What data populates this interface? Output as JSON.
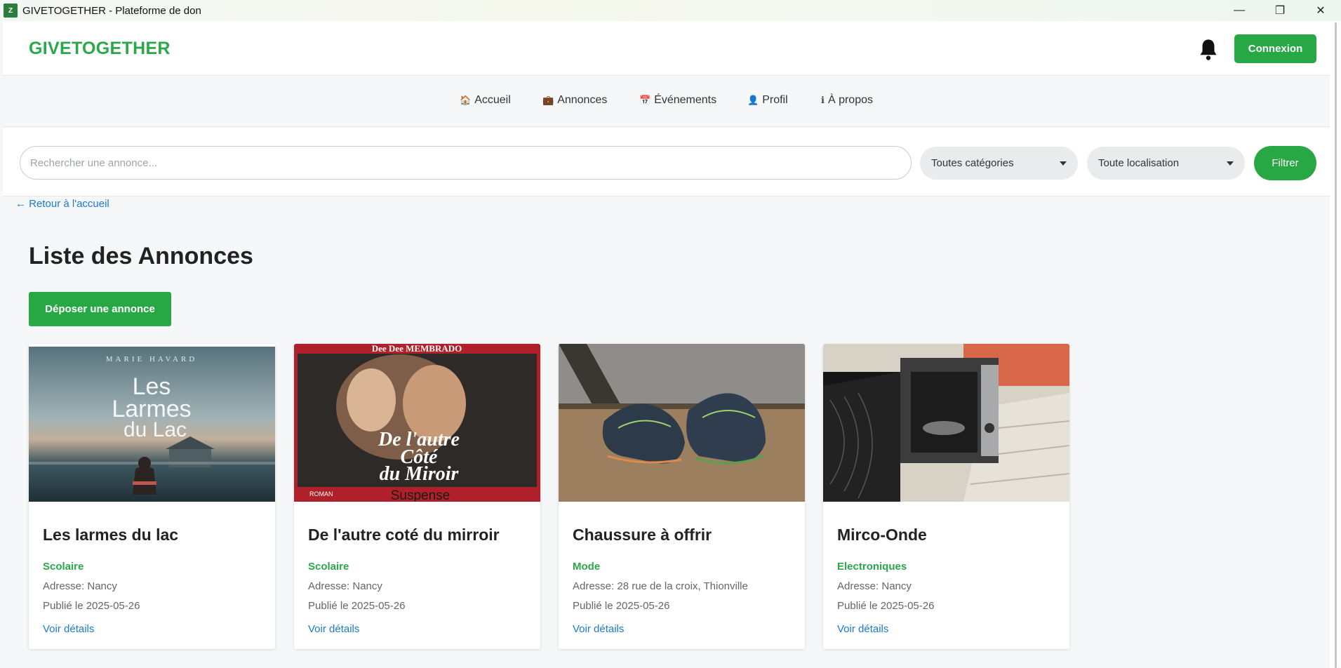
{
  "window": {
    "title": "GIVETOGETHER - Plateforme de don",
    "minimize_glyph": "—",
    "restore_glyph": "❐",
    "close_glyph": "✕"
  },
  "header": {
    "brand": "GIVETOGETHER",
    "login_label": "Connexion"
  },
  "nav": {
    "items": [
      {
        "icon": "🏠",
        "label": "Accueil"
      },
      {
        "icon": "💼",
        "label": "Annonces"
      },
      {
        "icon": "📅",
        "label": "Événements"
      },
      {
        "icon": "👤",
        "label": "Profil"
      },
      {
        "icon": "ℹ",
        "label": "À propos"
      }
    ]
  },
  "search": {
    "placeholder": "Rechercher une annonce...",
    "category_select": "Toutes catégories",
    "location_select": "Toute localisation",
    "filter_label": "Filtrer"
  },
  "content": {
    "back_link": "← Retour à l'accueil",
    "title": "Liste des Annonces",
    "post_button": "Déposer une annonce"
  },
  "cards": [
    {
      "title": "Les larmes du lac",
      "category": "Scolaire",
      "address": "Adresse: Nancy",
      "published": "Publié le 2025-05-26",
      "link": "Voir détails",
      "image_author": "MARIE HAVARD",
      "image_text": [
        "Les",
        "Larmes",
        "du Lac"
      ]
    },
    {
      "title": "De l'autre coté du mirroir",
      "category": "Scolaire",
      "address": "Adresse: Nancy",
      "published": "Publié le 2025-05-26",
      "link": "Voir détails",
      "image_author": "Dee Dee MEMBRADO",
      "image_text": [
        "De l'autre",
        "Côté",
        "du Miroir"
      ],
      "image_genre": "ROMAN",
      "image_sub": "Suspense"
    },
    {
      "title": "Chaussure à offrir",
      "category": "Mode",
      "address": "Adresse: 28 rue de la croix, Thionville",
      "published": "Publié le 2025-05-26",
      "link": "Voir détails"
    },
    {
      "title": "Mirco-Onde",
      "category": "Electroniques",
      "address": "Adresse: Nancy",
      "published": "Publié le 2025-05-26",
      "link": "Voir détails"
    }
  ],
  "colors": {
    "accent": "#28a745",
    "brand": "#2aa84a",
    "link": "#1a7ad4"
  }
}
